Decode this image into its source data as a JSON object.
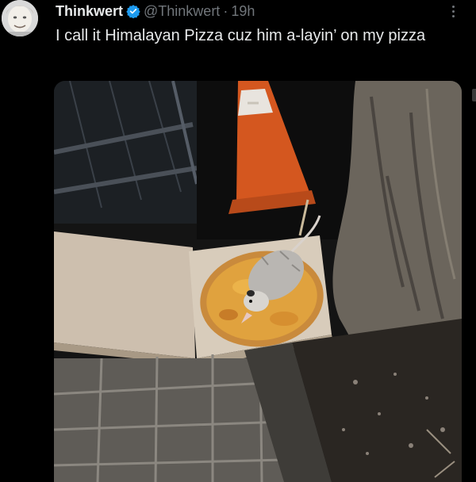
{
  "tweet": {
    "display_name": "Thinkwert",
    "handle": "@Thinkwert",
    "separator": "·",
    "time": "19h",
    "text": "I call it Himalayan Pizza cuz him a-layin’ on my pizza"
  },
  "icons": {
    "verified": "verified-badge-icon",
    "more": "more-options-icon"
  },
  "colors": {
    "background": "#000000",
    "primary_text": "#e7e9ea",
    "secondary_text": "#71767b",
    "verified_blue": "#1d9bf0"
  }
}
